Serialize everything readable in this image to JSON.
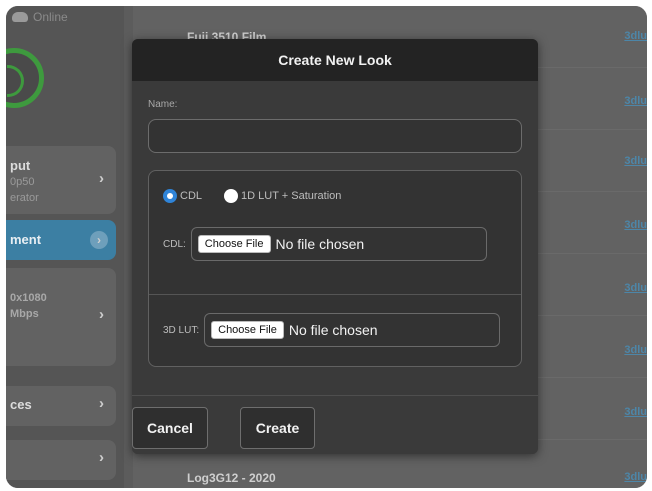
{
  "status": {
    "text": "Online"
  },
  "sidebar": {
    "cards": [
      {
        "title": "put",
        "sub1": "0p50",
        "sub2": "erator"
      },
      {
        "title": "ment"
      },
      {
        "title": "0x1080",
        "sub1": "Mbps"
      },
      {
        "title": "ces"
      },
      {
        "title": ""
      }
    ],
    "chevron": "›"
  },
  "list": {
    "rows": [
      {
        "label": "Fuji 3510 Film",
        "link": "3dlu"
      },
      {
        "label": "",
        "link": "3dlu"
      },
      {
        "label": "",
        "link": "3dlu"
      },
      {
        "label": "",
        "link": "3dlu"
      },
      {
        "label": "",
        "link": "3dlu"
      },
      {
        "label": "",
        "link": "3dlu"
      },
      {
        "label": "",
        "link": "3dlu"
      },
      {
        "label": "Log3G12 - 2020",
        "link": "3dlu"
      }
    ]
  },
  "modal": {
    "title": "Create New Look",
    "name_label": "Name:",
    "name_value": "",
    "radio_cdl": "CDL",
    "radio_1dlut": "1D LUT + Saturation",
    "cdl_label": "CDL:",
    "lut3d_label": "3D LUT:",
    "choose_file": "Choose File",
    "no_file": "No file chosen",
    "cancel": "Cancel",
    "create": "Create"
  },
  "colors": {
    "accent": "#3c7fa3",
    "logo": "#3e9a3e",
    "radio_selected": "#2f84d8",
    "link": "#4d86a8"
  }
}
